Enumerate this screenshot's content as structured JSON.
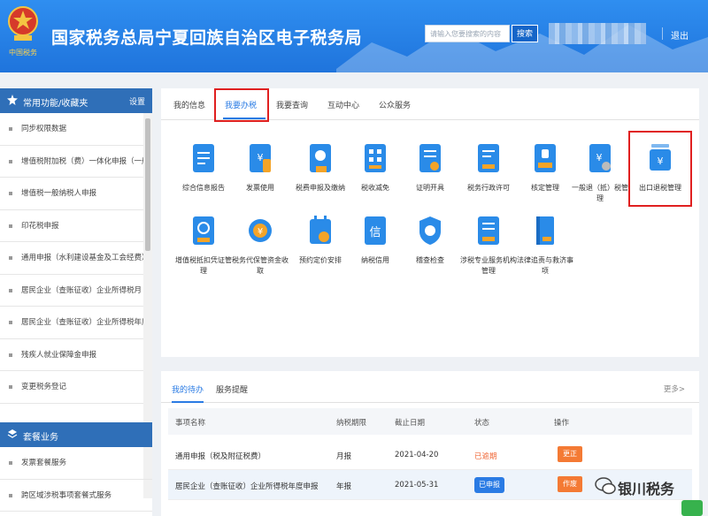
{
  "header": {
    "emblem_caption": "中国税务",
    "title": "国家税务总局宁夏回族自治区电子税务局",
    "search_placeholder": "请输入您要搜索的内容",
    "search_button": "搜索",
    "logout": "退出"
  },
  "sidebar": {
    "section1_title": "常用功能/收藏夹",
    "settings": "设置",
    "items": [
      "同步权限数据",
      "增值税附加税（费）一体化申报（一般…",
      "增值税一般纳税人申报",
      "印花税申报",
      "通用申报（水利建设基金及工会经费）",
      "居民企业（查账征收）企业所得税月（…",
      "居民企业（查账征收）企业所得税年度…",
      "残疾人就业保障金申报",
      "变更税务登记"
    ],
    "section2_title": "套餐业务",
    "items2": [
      "发票套餐服务",
      "跨区域涉税事项套餐式服务"
    ]
  },
  "main": {
    "tabs": [
      "我的信息",
      "我要办税",
      "我要查询",
      "互动中心",
      "公众服务"
    ],
    "tiles": [
      "综合信息报告",
      "发票使用",
      "税费申报及缴纳",
      "税收减免",
      "证明开具",
      "税务行政许可",
      "核定管理",
      "一般退（抵）税管理",
      "出口退税管理",
      "增值税抵扣凭证管理",
      "税务代保管资金收取",
      "预约定价安排",
      "纳税信用",
      "稽查检查",
      "涉税专业服务机构管理",
      "法律追责与救济事项"
    ]
  },
  "tasks": {
    "tabs": [
      "我的待办",
      "服务提醒"
    ],
    "more": "更多>",
    "columns": [
      "事项名称",
      "纳税期限",
      "截止日期",
      "状态",
      "操作"
    ],
    "rows": [
      {
        "name": "通用申报（税及附征税费）",
        "period": "月报",
        "deadline": "2021-04-20",
        "status": "已逾期",
        "action": "更正"
      },
      {
        "name": "居民企业（查账征收）企业所得税年度申报",
        "period": "年报",
        "deadline": "2021-05-31",
        "status": "已申报",
        "action": "作废"
      }
    ]
  },
  "watermark": "银川税务",
  "colors": {
    "header_blue": "#2f8ef0",
    "sidebar_head": "#2f6fb8",
    "accent": "#2a7be4",
    "highlight": "#e02020",
    "orange": "#f47a34"
  }
}
